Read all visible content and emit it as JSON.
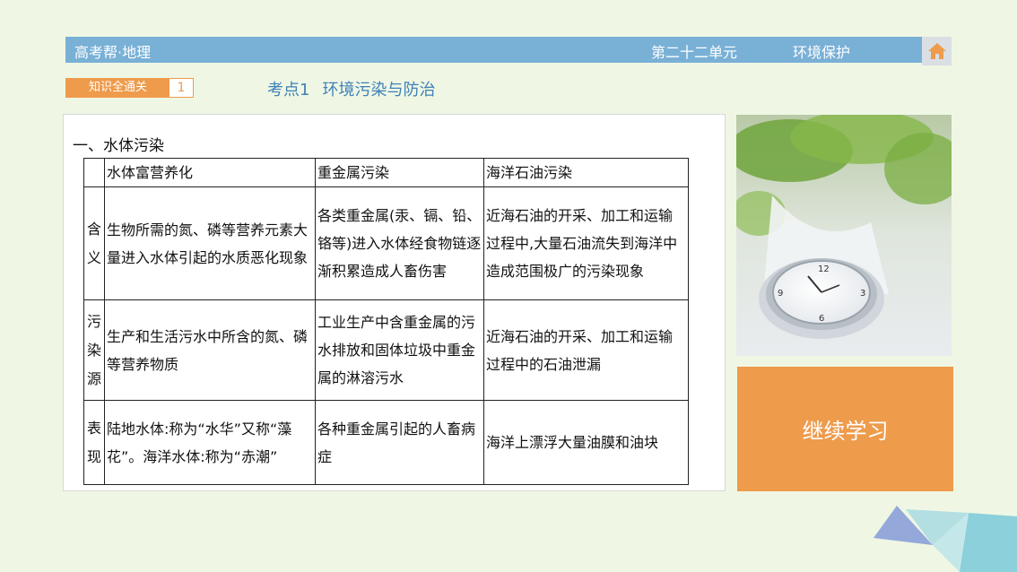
{
  "header": {
    "brand": "高考帮·地理",
    "unit": "第二十二单元",
    "topic": "环境保护"
  },
  "tag": {
    "label": "知识全通关",
    "number": "1"
  },
  "point": {
    "number": "考点1",
    "title": "环境污染与防治"
  },
  "section": {
    "heading": "一、水体污染"
  },
  "table": {
    "columns": [
      "水体富营养化",
      "重金属污染",
      "海洋石油污染"
    ],
    "rows": [
      {
        "label": "含义",
        "cells": [
          "生物所需的氮、磷等营养元素大量进入水体引起的水质恶化现象",
          "各类重金属(汞、镉、铅、铬等)进入水体经食物链逐渐积累造成人畜伤害",
          "近海石油的开采、加工和运输过程中,大量石油流失到海洋中造成范围极广的污染现象"
        ]
      },
      {
        "label": "污染源",
        "cells": [
          "生产和生活污水中所含的氮、磷等营养物质",
          "工业生产中含重金属的污水排放和固体垃圾中重金属的淋溶污水",
          "近海石油的开采、加工和运输过程中的石油泄漏"
        ]
      },
      {
        "label": "表现",
        "cells": [
          "陆地水体:称为“水华”又称“藻花”。海洋水体:称为“赤潮”",
          "各种重金属引起的人畜病症",
          "海洋上漂浮大量油膜和油块"
        ]
      }
    ]
  },
  "continue_button": {
    "label": "继续学习"
  },
  "colors": {
    "background": "#eff7e4",
    "header_bar": "#79b0d6",
    "accent_orange": "#ee9b4c",
    "title_blue": "#3f80b8"
  },
  "icons": {
    "home": "home-icon"
  }
}
